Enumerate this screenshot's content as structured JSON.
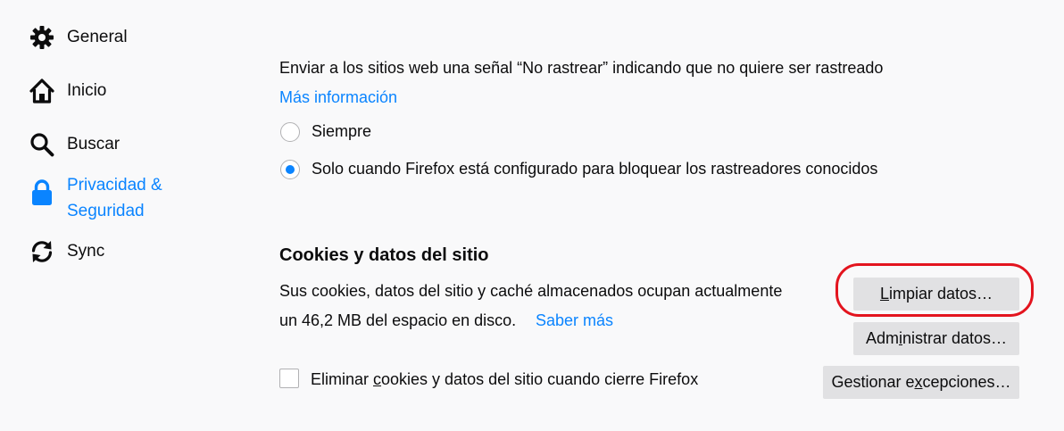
{
  "sidebar": {
    "items": [
      {
        "label": "General",
        "icon": "gear-icon",
        "selected": false
      },
      {
        "label": "Inicio",
        "icon": "home-icon",
        "selected": false
      },
      {
        "label": "Buscar",
        "icon": "search-icon",
        "selected": false
      },
      {
        "label": "Privacidad & Seguridad",
        "icon": "lock-icon",
        "selected": true
      },
      {
        "label": "Sync",
        "icon": "sync-icon",
        "selected": false
      }
    ]
  },
  "dnt": {
    "description": "Enviar a los sitios web una señal “No rastrear” indicando que no quiere ser rastreado",
    "more_info_link": "Más información",
    "options": [
      {
        "label": "Siempre",
        "checked": false
      },
      {
        "label": "Solo cuando Firefox está configurado para bloquear los rastreadores conocidos",
        "checked": true
      }
    ]
  },
  "cookies": {
    "heading": "Cookies y datos del sitio",
    "usage_line1": "Sus cookies, datos del sitio y caché almacenados ocupan actualmente",
    "usage_line2": "un 46,2 MB del espacio en disco.",
    "learn_more_link": "Saber más",
    "delete_on_close_label": "Eliminar cookies y datos del sitio cuando cierre Firefox",
    "delete_on_close_checked": false,
    "clear_data_button": {
      "accesskey": "L",
      "rest": "impiar datos…"
    },
    "manage_data_button": {
      "before": "Adm",
      "accesskey": "i",
      "after": "nistrar datos…"
    },
    "manage_exceptions_button": {
      "before": "Gestionar e",
      "accesskey": "x",
      "after": "cepciones…"
    }
  },
  "colors": {
    "accent": "#0a84ff",
    "highlight": "#e3141e",
    "button_bg": "#e1e1e3",
    "page_bg": "#f9f9fa"
  }
}
